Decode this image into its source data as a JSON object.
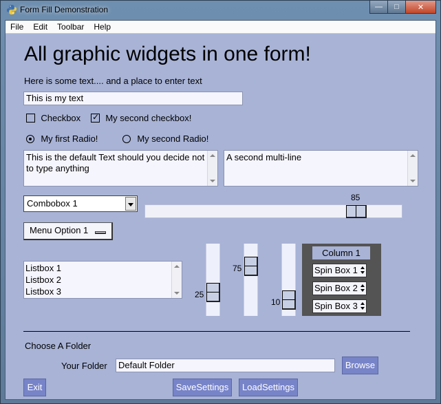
{
  "window": {
    "title": "Form Fill Demonstration",
    "buttons": {
      "minimize": "—",
      "maximize": "□",
      "close": "✕"
    }
  },
  "menu": [
    "File",
    "Edit",
    "Toolbar",
    "Help"
  ],
  "heading": "All graphic widgets in one form!",
  "intro_text": "Here is some text.... and a place to enter text",
  "text_input_value": "This is my text",
  "checkboxes": [
    {
      "label": "Checkbox",
      "checked": false
    },
    {
      "label": "My second checkbox!",
      "checked": true
    }
  ],
  "radios": [
    {
      "label": "My first Radio!",
      "selected": true
    },
    {
      "label": "My second Radio!",
      "selected": false
    }
  ],
  "multiline_1": "This is the default Text should you decide not to type anything",
  "multiline_2": "A second multi-line",
  "combobox_value": "Combobox 1",
  "horizontal_slider": {
    "value": "85",
    "min": 0,
    "max": 100
  },
  "option_menu_value": "Menu Option 1",
  "listbox_items": [
    "Listbox 1",
    "Listbox 2",
    "Listbox 3"
  ],
  "vertical_sliders": [
    {
      "value": "25"
    },
    {
      "value": "75"
    },
    {
      "value": "10"
    }
  ],
  "column_frame": {
    "title": "Column 1",
    "spin_boxes": [
      "Spin Box 1",
      "Spin Box 2",
      "Spin Box 3"
    ]
  },
  "folder_section": {
    "heading": "Choose A Folder",
    "label": "Your Folder",
    "value": "Default Folder",
    "browse_label": "Browse"
  },
  "bottom_buttons": {
    "exit": "Exit",
    "save": "SaveSettings",
    "load": "LoadSettings"
  },
  "colors": {
    "background": "#a8b3d6",
    "button": "#7884c8",
    "field": "#f5f5fd",
    "frame": "#545454"
  }
}
